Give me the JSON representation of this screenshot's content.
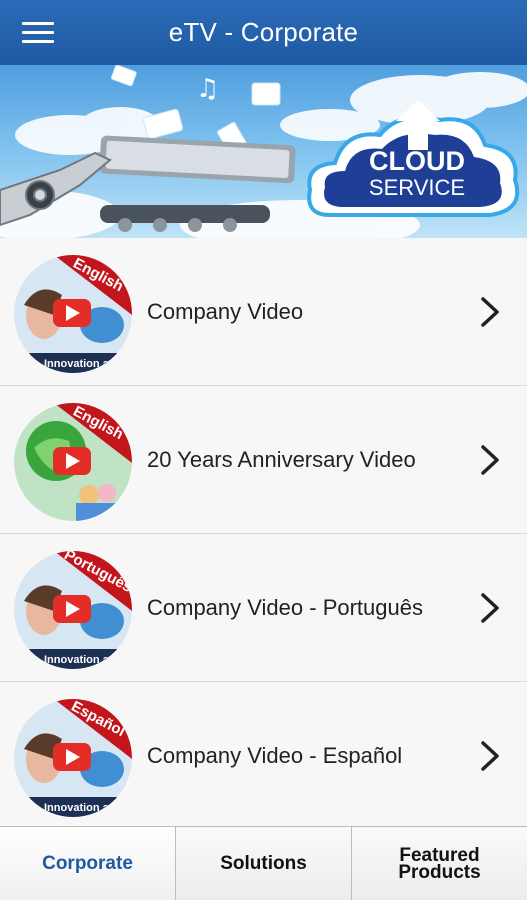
{
  "app": {
    "title": "eTV - Corporate"
  },
  "banner": {
    "cloud_line1": "CLOUD",
    "cloud_line2": "SERVICE"
  },
  "videos": [
    {
      "label": "Company Video",
      "badge": "English",
      "caption": "Innovation a",
      "theme": "team"
    },
    {
      "label": "20 Years Anniversary Video",
      "badge": "English",
      "caption": "",
      "theme": "globe"
    },
    {
      "label": "Company Video - Português",
      "badge": "Português",
      "caption": "Innovation a",
      "theme": "team"
    },
    {
      "label": "Company Video - Español",
      "badge": "Español",
      "caption": "Innovation a",
      "theme": "team"
    }
  ],
  "tabs": [
    {
      "line1": "Corporate",
      "line2": "",
      "active": true
    },
    {
      "line1": "Solutions",
      "line2": "",
      "active": false
    },
    {
      "line1": "Featured",
      "line2": "Products",
      "active": false
    }
  ],
  "colors": {
    "appbar": "#1f5aa3",
    "active_tab": "#1f5aa3",
    "badge": "#c3161c",
    "play": "#e52d27"
  }
}
